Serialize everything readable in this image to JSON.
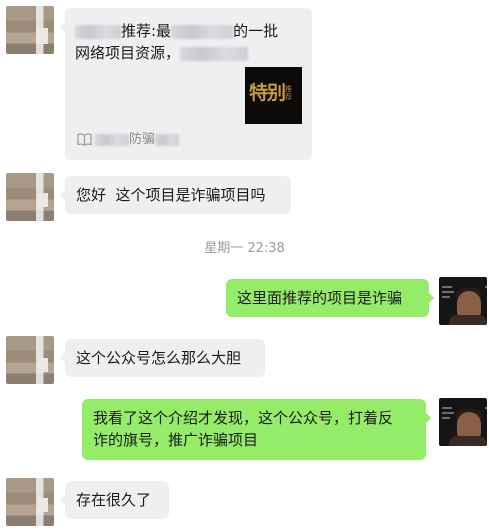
{
  "chat": {
    "messages": [
      {
        "side": "left",
        "type": "article",
        "title_suffix": "推荐:最",
        "title_mid": "的一批",
        "line2": "网络项目资源，",
        "thumb_text": "特别",
        "thumb_small": "推荐",
        "source_suffix": "防骗",
        "source_icon": "book-icon"
      },
      {
        "side": "left",
        "type": "text",
        "text": "您好  这个项目是诈骗项目吗"
      },
      {
        "type": "timestamp",
        "text": "星期一 22:38"
      },
      {
        "side": "right",
        "type": "text",
        "text": "这里面推荐的项目是诈骗"
      },
      {
        "side": "left",
        "type": "text",
        "text": "这个公众号怎么那么大胆"
      },
      {
        "side": "right",
        "type": "text",
        "line1": "我看了这个介绍才发现，这个公众号，打着反",
        "line2": "诈的旗号，推广诈骗项目"
      },
      {
        "side": "left",
        "type": "text",
        "text": "存在很久了"
      }
    ]
  },
  "colors": {
    "incoming_bubble": "#efeff2",
    "outgoing_bubble": "#95ec69",
    "timestamp": "#9c9c9c"
  }
}
